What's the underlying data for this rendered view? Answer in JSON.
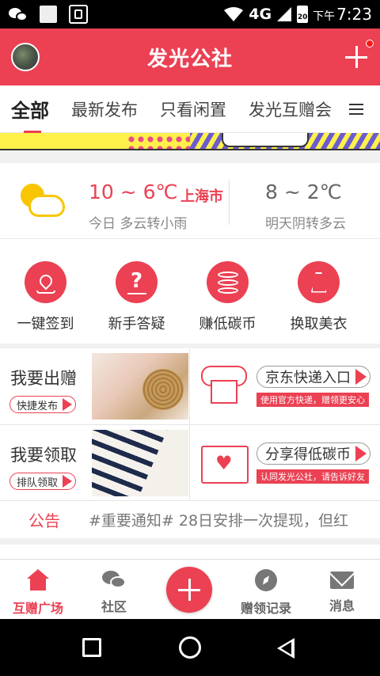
{
  "status_bar": {
    "network": "4G",
    "battery": "20",
    "time_prefix": "下午",
    "time": "7:23"
  },
  "header": {
    "title": "发光公社"
  },
  "tabs": [
    {
      "label": "全部",
      "active": true
    },
    {
      "label": "最新发布"
    },
    {
      "label": "只看闲置"
    },
    {
      "label": "发光互赠会"
    }
  ],
  "weather": {
    "today_temp": "10 ~ 6℃",
    "city": "上海市",
    "today_desc": "今日 多云转小雨",
    "tomorrow_temp": "8 ~ 2℃",
    "tomorrow_desc": "明天阴转多云"
  },
  "quick_actions": [
    {
      "label": "一键签到",
      "icon": "location-pin-icon"
    },
    {
      "label": "新手答疑",
      "icon": "question-icon"
    },
    {
      "label": "赚低碳币",
      "icon": "coins-icon"
    },
    {
      "label": "换取美衣",
      "icon": "dress-icon"
    }
  ],
  "promos": {
    "give": {
      "title": "我要出赠",
      "pill": "快捷发布"
    },
    "receive": {
      "title": "我要领取",
      "pill": "排队领取"
    },
    "express": {
      "title": "京东快递入口",
      "subtitle": "使用官方快递，赠领更安心"
    },
    "share": {
      "title": "分享得低碳币",
      "subtitle": "认同发光公社，请告诉好友"
    }
  },
  "notice": {
    "label": "公告",
    "text": "#重要通知# 28日安排一次提现，但红"
  },
  "bottom_nav": [
    {
      "label": "互赠广场",
      "active": true
    },
    {
      "label": "社区"
    },
    {
      "label": "赠领记录"
    },
    {
      "label": "消息"
    }
  ],
  "colors": {
    "brand": "#eb4153"
  }
}
